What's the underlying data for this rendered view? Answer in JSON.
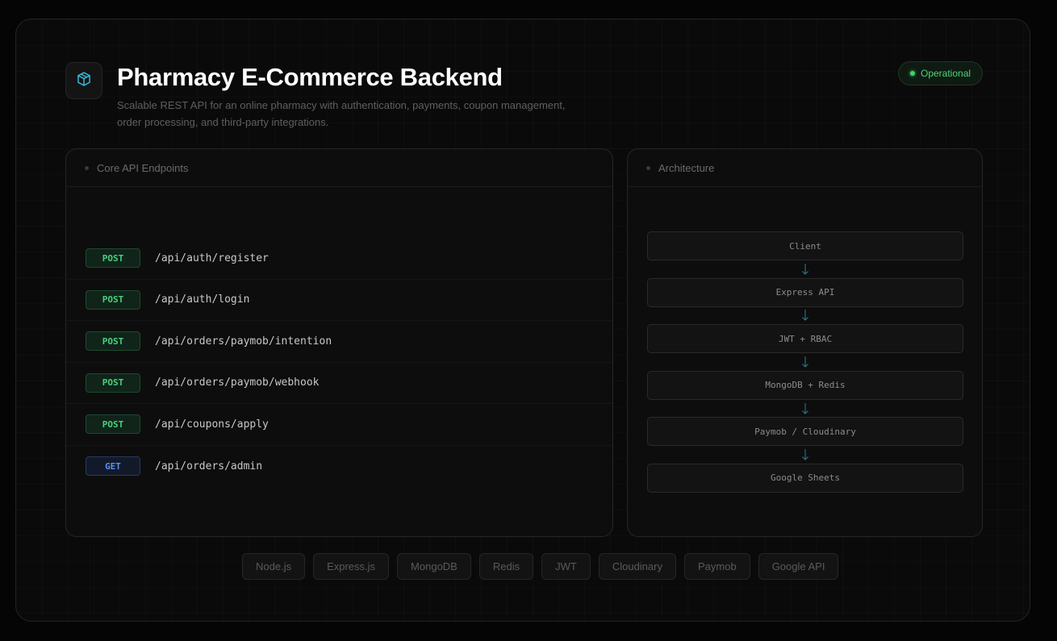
{
  "header": {
    "title": "Pharmacy E-Commerce Backend",
    "subtitle": "Scalable REST API for an online pharmacy with authentication, payments, coupon management, order processing, and third-party integrations.",
    "status": "Operational",
    "logo_icon": "cube-icon"
  },
  "endpoints_panel": {
    "title": "Core API Endpoints",
    "endpoints": [
      {
        "method": "POST",
        "path": "/api/auth/register"
      },
      {
        "method": "POST",
        "path": "/api/auth/login"
      },
      {
        "method": "POST",
        "path": "/api/orders/paymob/intention"
      },
      {
        "method": "POST",
        "path": "/api/orders/paymob/webhook"
      },
      {
        "method": "POST",
        "path": "/api/coupons/apply"
      },
      {
        "method": "GET",
        "path": "/api/orders/admin"
      }
    ]
  },
  "architecture_panel": {
    "title": "Architecture",
    "nodes": [
      "Client",
      "Express API",
      "JWT + RBAC",
      "MongoDB + Redis",
      "Paymob / Cloudinary",
      "Google Sheets"
    ]
  },
  "tech_stack": [
    "Node.js",
    "Express.js",
    "MongoDB",
    "Redis",
    "JWT",
    "Cloudinary",
    "Paymob",
    "Google API"
  ],
  "colors": {
    "accent": "#38b6d8",
    "status_green": "#3fd36a",
    "post_green": "#47d27b",
    "get_blue": "#5b8ef0"
  }
}
